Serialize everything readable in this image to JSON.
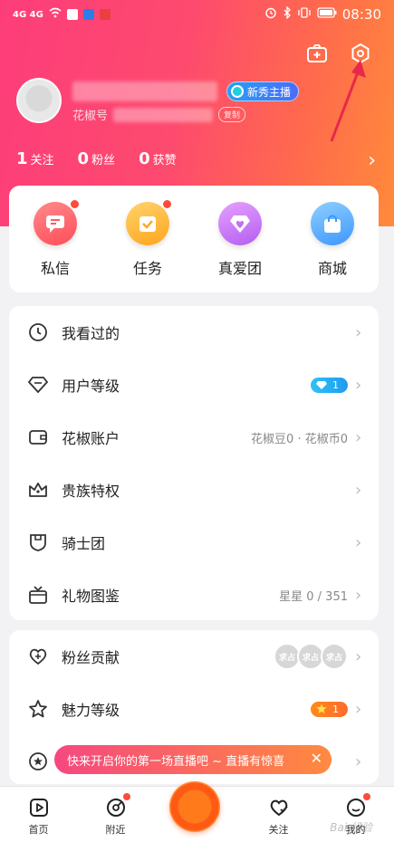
{
  "status_bar": {
    "left": "4G  4G",
    "time": "08:30"
  },
  "profile": {
    "name_blurred": "",
    "badge": "新秀主播",
    "id_prefix": "花椒号",
    "copy": "复制",
    "stats": [
      {
        "num": "1",
        "label": "关注"
      },
      {
        "num": "0",
        "label": "粉丝"
      },
      {
        "num": "0",
        "label": "获赞"
      }
    ]
  },
  "quick_actions": [
    {
      "label": "私信",
      "color": "#ff5a5f",
      "dot": true
    },
    {
      "label": "任务",
      "color": "#ffb53d",
      "dot": true
    },
    {
      "label": "真爱团",
      "color": "#c86bf5",
      "dot": false
    },
    {
      "label": "商城",
      "color": "#4fa8ff",
      "dot": false
    }
  ],
  "menu": {
    "history": "我看过的",
    "user_level": "用户等级",
    "user_level_value": "1",
    "account": "花椒账户",
    "account_value": "花椒豆0 · 花椒币0",
    "noble": "贵族特权",
    "knight": "骑士团",
    "gifts": "礼物图鉴",
    "gifts_value": "星星 0 / 351",
    "fans_contrib": "粉丝贡献",
    "fans_avatar_text": "求占",
    "charm": "魅力等级",
    "charm_value": "1"
  },
  "toast": {
    "text": "快来开启你的第一场直播吧 ~ 直播有惊喜",
    "close": "✕"
  },
  "tabbar": {
    "home": "首页",
    "nearby": "附近",
    "follow": "关注",
    "mine": "我的"
  },
  "watermark": "Bai 经验"
}
